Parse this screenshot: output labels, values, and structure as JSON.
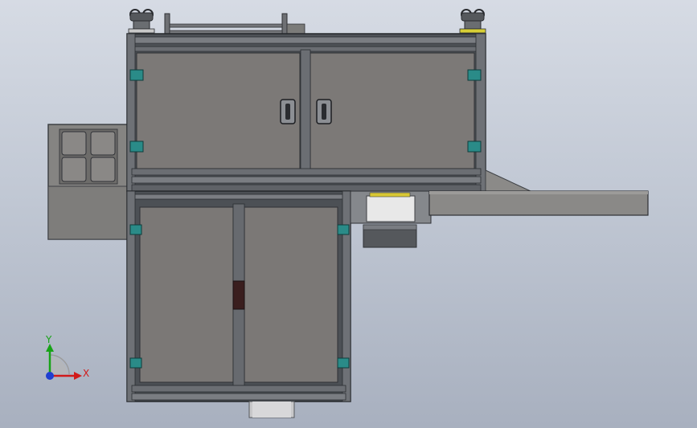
{
  "triad": {
    "x_label": "X",
    "y_label": "Y",
    "colors": {
      "x": "#d11a1a",
      "y": "#17a317",
      "z": "#1f3fd1"
    }
  },
  "model": {
    "panel_color": "#7d7a78",
    "frame_color": "#4c5055",
    "connector_color": "#1e8f8c"
  }
}
